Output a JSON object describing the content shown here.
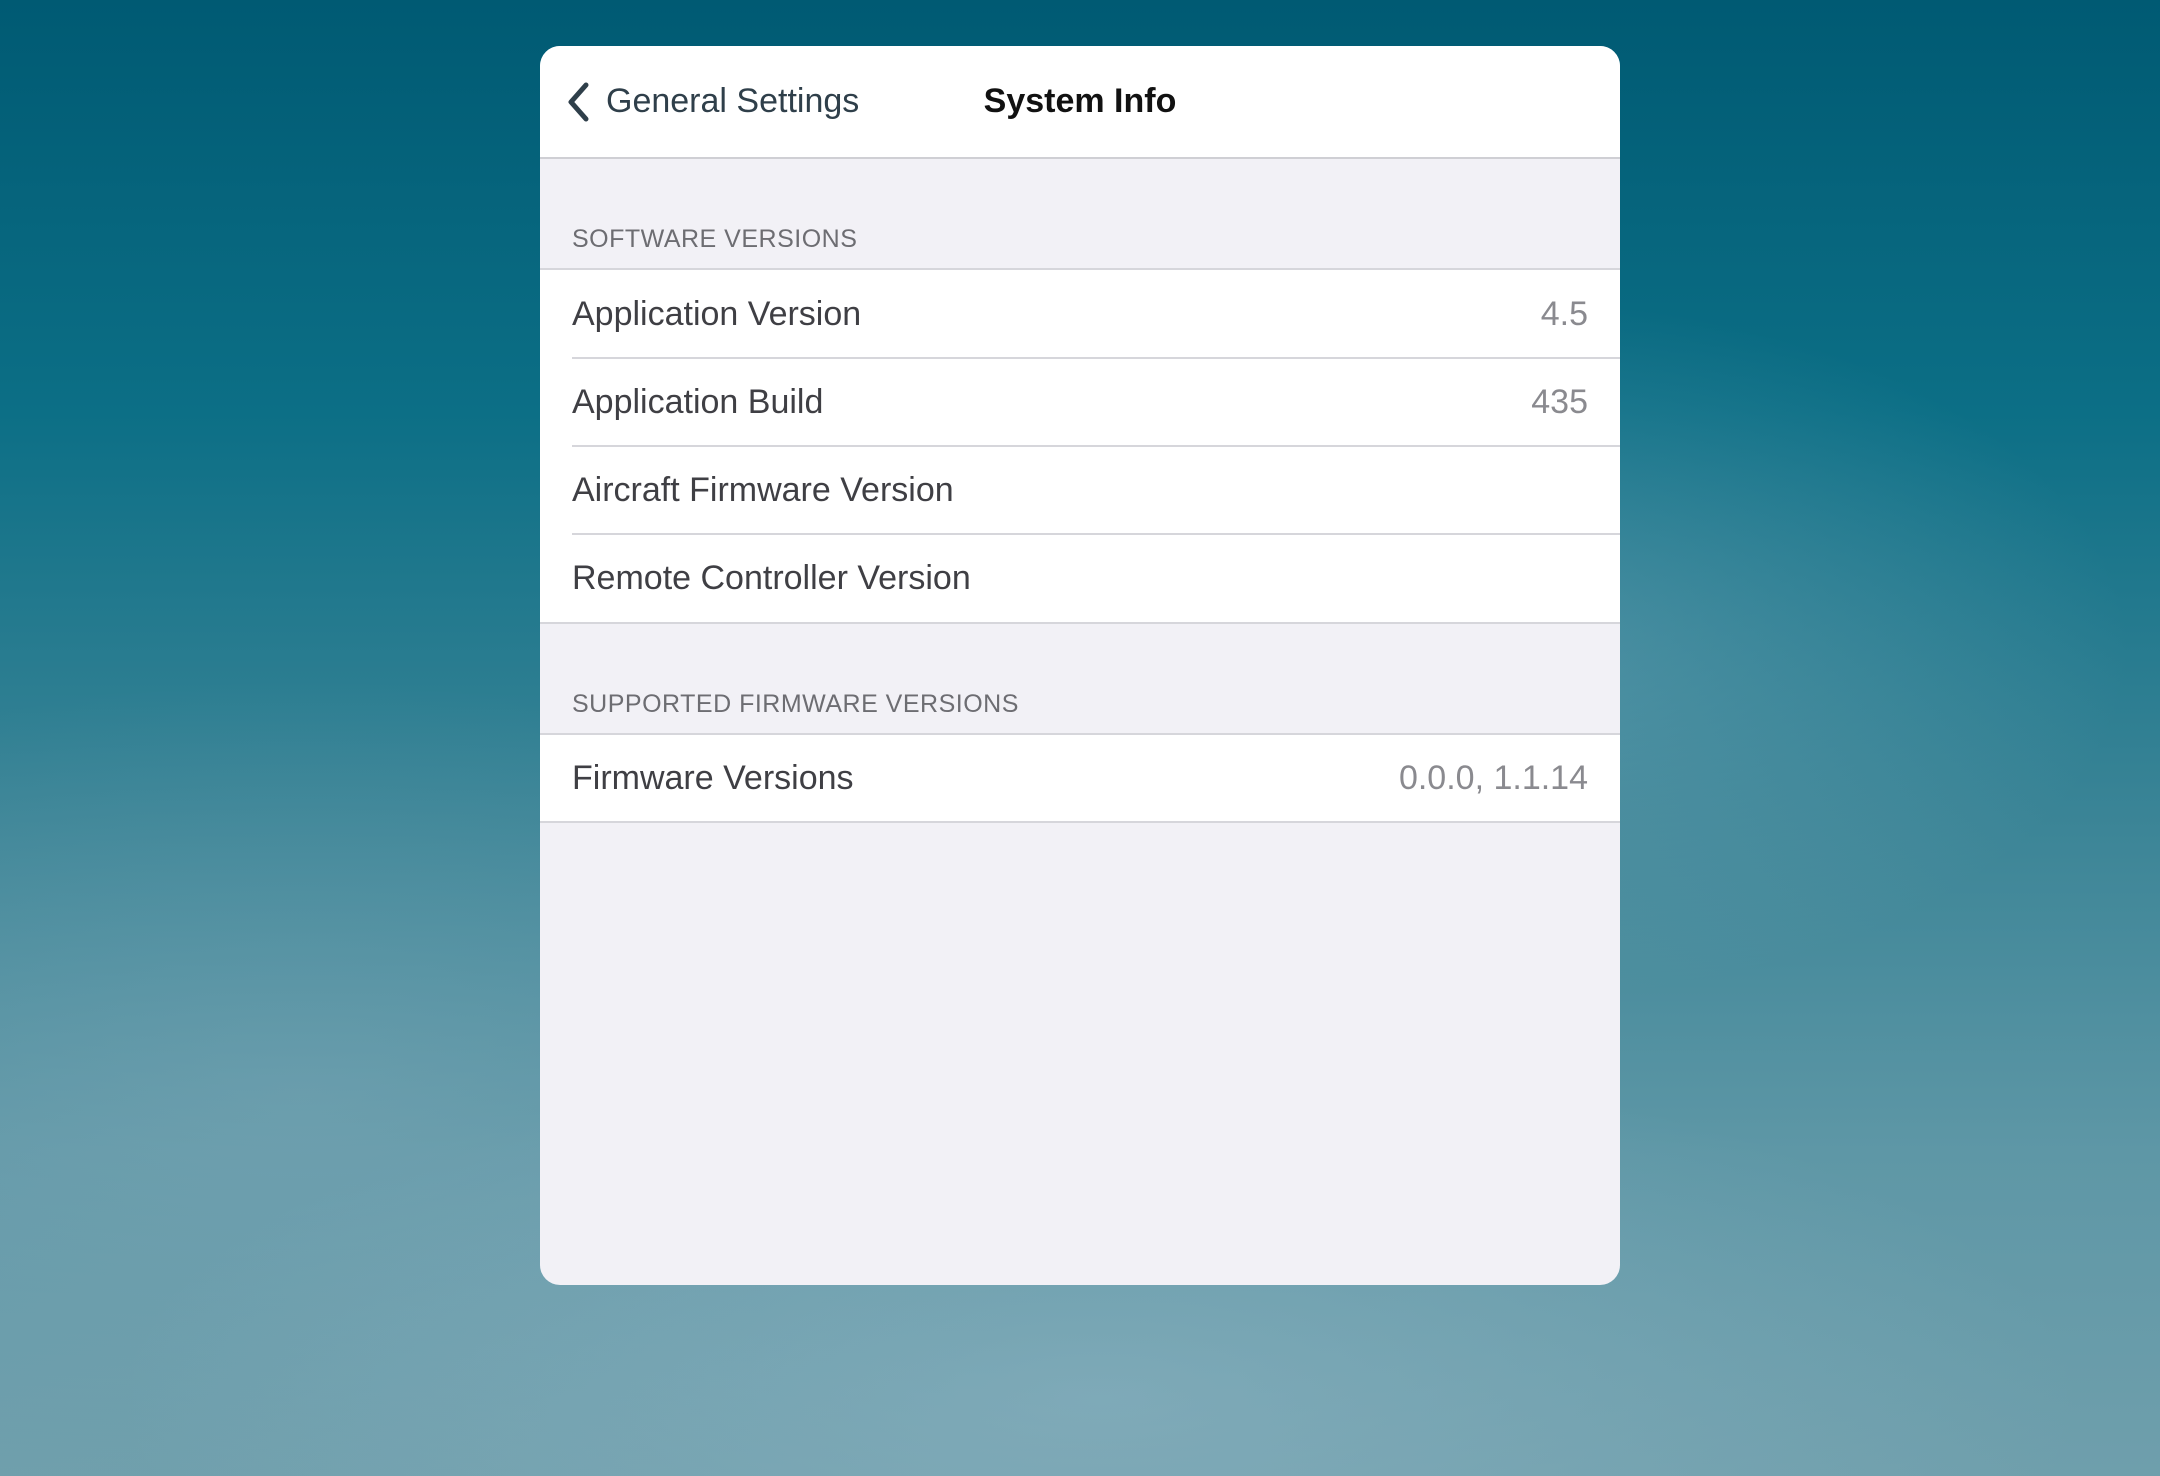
{
  "colors": {
    "panel_background": "#f2f1f6",
    "navbar_background": "#ffffff",
    "label_text": "#3f3f44",
    "value_text": "#8a8a8f",
    "section_header_text": "#6d6d72"
  },
  "navbar": {
    "back_label": "General Settings",
    "back_icon": "chevron-left-icon",
    "title": "System Info"
  },
  "sections": {
    "software": {
      "header": "SOFTWARE VERSIONS",
      "rows": [
        {
          "label": "Application Version",
          "value": "4.5"
        },
        {
          "label": "Application Build",
          "value": "435"
        },
        {
          "label": "Aircraft Firmware Version",
          "value": ""
        },
        {
          "label": "Remote Controller Version",
          "value": ""
        }
      ]
    },
    "firmware": {
      "header": "SUPPORTED FIRMWARE VERSIONS",
      "rows": [
        {
          "label": "Firmware Versions",
          "value": "0.0.0, 1.1.14"
        }
      ]
    }
  }
}
